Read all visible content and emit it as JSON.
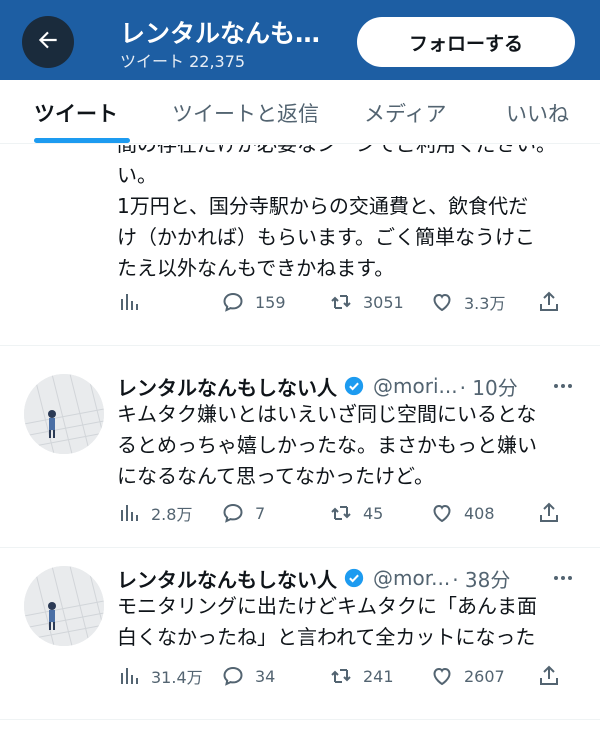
{
  "header": {
    "title": "レンタルなんも…",
    "tweet_count": "ツイート 22,375",
    "follow_label": "フォローする"
  },
  "tabs": [
    {
      "label": "ツイート",
      "active": true
    },
    {
      "label": "ツイートと返信",
      "active": false
    },
    {
      "label": "メディア",
      "active": false
    },
    {
      "label": "いいね",
      "active": false
    }
  ],
  "tweets": [
    {
      "partial_top": "間の存在だけが必要なシーンでご利用ください。",
      "lines": [
        "い。",
        "1万円と、国分寺駅からの交通費と、飲食代だ",
        "け（かかれば）もらいます。ごく簡単なうけこ",
        "たえ以外なんもできかねます。"
      ],
      "views": "",
      "replies": "159",
      "retweets": "3051",
      "likes": "3.3万"
    },
    {
      "name": "レンタルなんもしない人",
      "handle": "@mori...",
      "time": "· 10分",
      "lines": [
        "キムタク嫌いとはいえいざ同じ空間にいるとな",
        "るとめっちゃ嬉しかったな。まさかもっと嫌い",
        "になるなんて思ってなかったけど。"
      ],
      "views": "2.8万",
      "replies": "7",
      "retweets": "45",
      "likes": "408"
    },
    {
      "name": "レンタルなんもしない人",
      "handle": "@mor...",
      "time": "· 38分",
      "lines": [
        "モニタリングに出たけどキムタクに「あんま面",
        "白くなかったね」と言われて全カットになった"
      ],
      "views": "31.4万",
      "replies": "34",
      "retweets": "241",
      "likes": "2607"
    }
  ],
  "icons": {
    "back": "arrow-left-icon",
    "views": "bar-chart-icon",
    "reply": "speech-bubble-icon",
    "retweet": "retweet-arrows-icon",
    "like": "heart-icon",
    "share": "share-upload-icon",
    "verified": "verified-badge-icon",
    "more": "more-dots-icon"
  },
  "colors": {
    "header_bg": "#1d5ea3",
    "accent": "#1d9bf0",
    "muted": "#536471"
  }
}
